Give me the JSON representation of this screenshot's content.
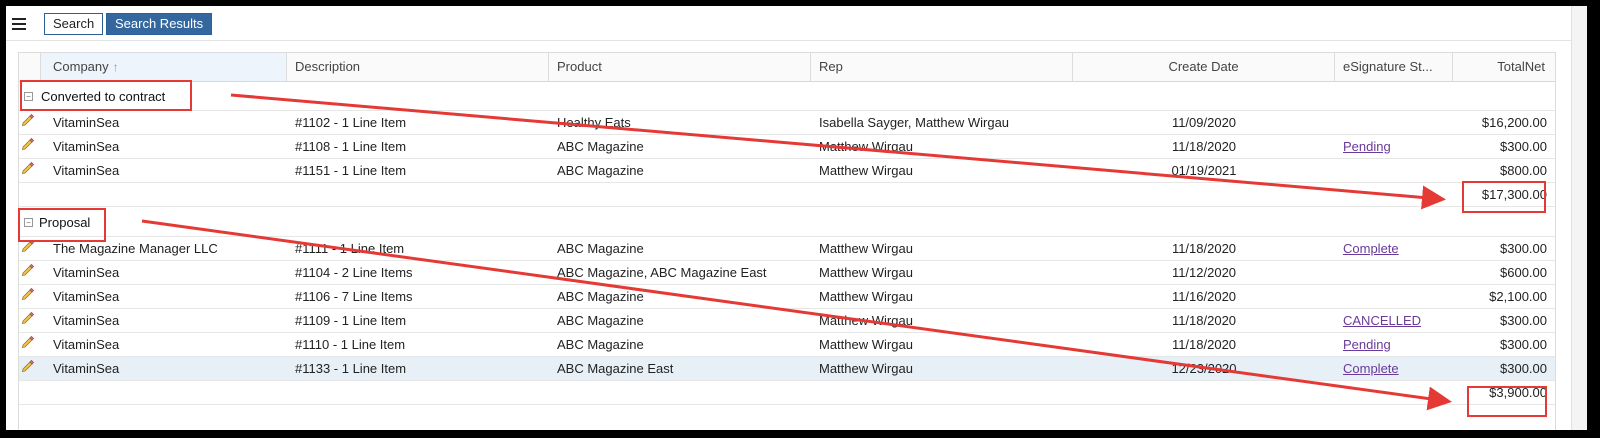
{
  "toolbar": {
    "menu_icon": "hamburger-menu-icon",
    "tabs": [
      {
        "label": "Search"
      },
      {
        "label": "Search Results"
      }
    ]
  },
  "grid": {
    "columns": [
      {
        "label": "Company",
        "sort": "ascending"
      },
      {
        "label": "Description"
      },
      {
        "label": "Product"
      },
      {
        "label": "Rep"
      },
      {
        "label": "Create Date"
      },
      {
        "label": "eSignature St..."
      },
      {
        "label": "TotalNet"
      }
    ],
    "groups": [
      {
        "label": "Converted to contract",
        "total": "$17,300.00",
        "rows": [
          {
            "company": "VitaminSea",
            "description": "#1102 - 1 Line Item",
            "product": "Healthy Eats",
            "rep": "Isabella Sayger, Matthew Wirgau",
            "create_date": "11/09/2020",
            "esignature": "",
            "totalnet": "$16,200.00"
          },
          {
            "company": "VitaminSea",
            "description": "#1108 - 1 Line Item",
            "product": "ABC Magazine",
            "rep": "Matthew Wirgau",
            "create_date": "11/18/2020",
            "esignature": "Pending",
            "totalnet": "$300.00"
          },
          {
            "company": "VitaminSea",
            "description": "#1151 - 1 Line Item",
            "product": "ABC Magazine",
            "rep": "Matthew Wirgau",
            "create_date": "01/19/2021",
            "esignature": "",
            "totalnet": "$800.00"
          }
        ]
      },
      {
        "label": "Proposal",
        "total": "$3,900.00",
        "rows": [
          {
            "company": "The Magazine Manager LLC",
            "description": "#1111 - 1 Line Item",
            "product": "ABC Magazine",
            "rep": "Matthew Wirgau",
            "create_date": "11/18/2020",
            "esignature": "Complete",
            "totalnet": "$300.00"
          },
          {
            "company": "VitaminSea",
            "description": "#1104 - 2 Line Items",
            "product": "ABC Magazine, ABC Magazine East",
            "rep": "Matthew Wirgau",
            "create_date": "11/12/2020",
            "esignature": "",
            "totalnet": "$600.00"
          },
          {
            "company": "VitaminSea",
            "description": "#1106 - 7 Line Items",
            "product": "ABC Magazine",
            "rep": "Matthew Wirgau",
            "create_date": "11/16/2020",
            "esignature": "",
            "totalnet": "$2,100.00"
          },
          {
            "company": "VitaminSea",
            "description": "#1109 - 1 Line Item",
            "product": "ABC Magazine",
            "rep": "Matthew Wirgau",
            "create_date": "11/18/2020",
            "esignature": "CANCELLED",
            "totalnet": "$300.00"
          },
          {
            "company": "VitaminSea",
            "description": "#1110 - 1 Line Item",
            "product": "ABC Magazine",
            "rep": "Matthew Wirgau",
            "create_date": "11/18/2020",
            "esignature": "Pending",
            "totalnet": "$300.00"
          },
          {
            "company": "VitaminSea",
            "description": "#1133 - 1 Line Item",
            "product": "ABC Magazine East",
            "rep": "Matthew Wirgau",
            "create_date": "12/23/2020",
            "esignature": "Complete",
            "totalnet": "$300.00",
            "selected": true
          }
        ]
      }
    ]
  },
  "annotations": {
    "color": "#e53935",
    "highlighted": [
      "Converted to contract",
      "$17,300.00",
      "Proposal",
      "$3,900.00"
    ]
  },
  "colors": {
    "active_tab": "#34679e",
    "link": "#6a3a9a",
    "selected_row": "#e8f0f7"
  }
}
